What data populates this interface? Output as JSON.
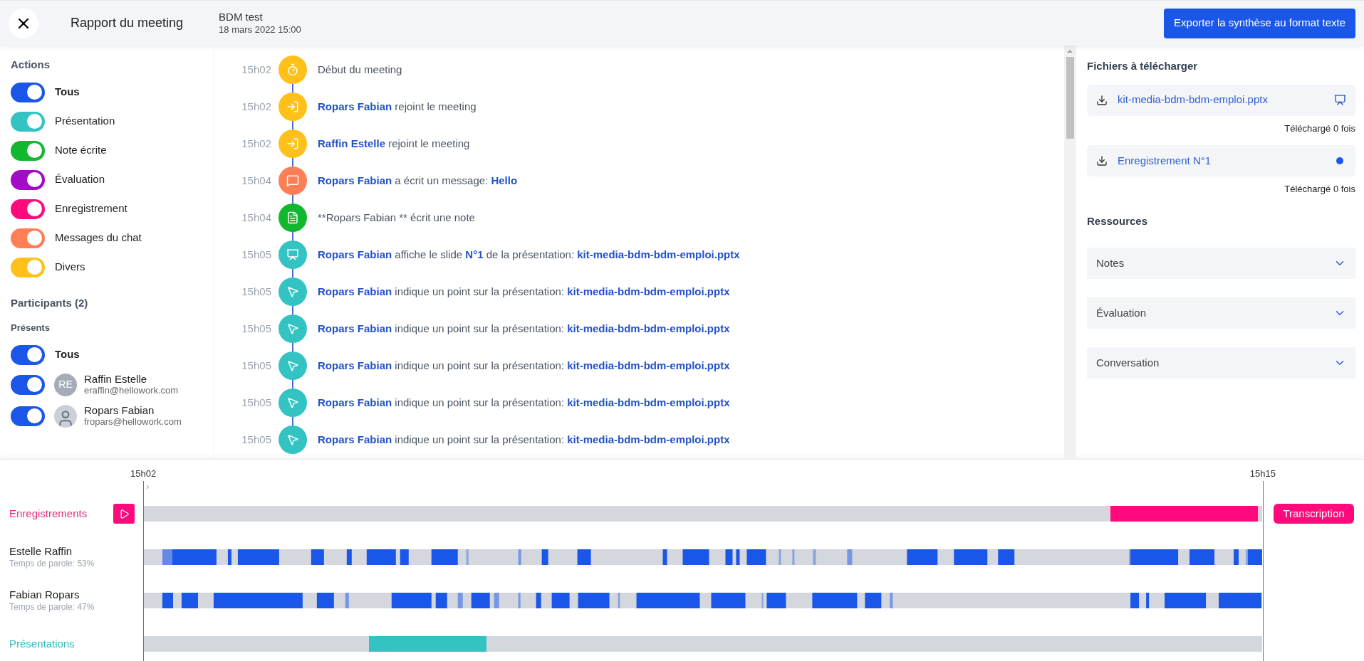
{
  "header": {
    "title": "Rapport du meeting",
    "meeting_name": "BDM test",
    "meeting_date": "18 mars 2022 15:00",
    "export_button": "Exporter la synthèse au format texte"
  },
  "actions": {
    "title": "Actions",
    "items": [
      {
        "label": "Tous",
        "on": true,
        "color": "#1a56e8",
        "bold": true
      },
      {
        "label": "Présentation",
        "on": true,
        "color": "#33c3c3",
        "bold": false
      },
      {
        "label": "Note écrite",
        "on": true,
        "color": "#10b72f",
        "bold": false
      },
      {
        "label": "Évaluation",
        "on": true,
        "color": "#a10cc4",
        "bold": false
      },
      {
        "label": "Enregistrement",
        "on": true,
        "color": "#ff0a7d",
        "bold": false
      },
      {
        "label": "Messages du chat",
        "on": true,
        "color": "#ff7e55",
        "bold": false
      },
      {
        "label": "Divers",
        "on": true,
        "color": "#ffc01a",
        "bold": false
      }
    ]
  },
  "participants": {
    "title": "Participants (2)",
    "subtitle": "Présents",
    "all": {
      "label": "Tous",
      "on": true
    },
    "people": [
      {
        "name": "Raffin Estelle",
        "email": "eraffin@hellowork.com",
        "on": true,
        "kind": "initials",
        "initials": "RE"
      },
      {
        "name": "Ropars Fabian",
        "email": "fropars@hellowork.com",
        "on": true,
        "kind": "photo"
      }
    ]
  },
  "events": [
    {
      "time": "15h02",
      "kind": "timer",
      "color": "#ffc01a",
      "text": "Début du meeting"
    },
    {
      "time": "15h02",
      "kind": "join",
      "color": "#ffc01a",
      "text": "**Ropars Fabian** rejoint le meeting"
    },
    {
      "time": "15h02",
      "kind": "join",
      "color": "#ffc01a",
      "text": "**Raffin Estelle** rejoint le meeting"
    },
    {
      "time": "15h04",
      "kind": "chat",
      "color": "#ff7e55",
      "text": "**Ropars Fabian** a écrit un message: **Hello**"
    },
    {
      "time": "15h04",
      "kind": "note",
      "color": "#10b72f",
      "text": "**Ropars Fabian ** écrit une note"
    },
    {
      "time": "15h05",
      "kind": "slide",
      "color": "#33c3c3",
      "text": "**Ropars Fabian** affiche le slide **N°1** de la présentation: **kit-media-bdm-bdm-emploi.pptx**"
    },
    {
      "time": "15h05",
      "kind": "pointer",
      "color": "#33c3c3",
      "text": "**Ropars Fabian** indique un point sur la présentation: **kit-media-bdm-bdm-emploi.pptx**"
    },
    {
      "time": "15h05",
      "kind": "pointer",
      "color": "#33c3c3",
      "text": "**Ropars Fabian** indique un point sur la présentation: **kit-media-bdm-bdm-emploi.pptx**"
    },
    {
      "time": "15h05",
      "kind": "pointer",
      "color": "#33c3c3",
      "text": "**Ropars Fabian** indique un point sur la présentation: **kit-media-bdm-bdm-emploi.pptx**"
    },
    {
      "time": "15h05",
      "kind": "pointer",
      "color": "#33c3c3",
      "text": "**Ropars Fabian** indique un point sur la présentation: **kit-media-bdm-bdm-emploi.pptx**"
    },
    {
      "time": "15h05",
      "kind": "pointer",
      "color": "#33c3c3",
      "text": "**Ropars Fabian** indique un point sur la présentation: **kit-media-bdm-bdm-emploi.pptx**"
    }
  ],
  "files": {
    "title": "Fichiers à télécharger",
    "items": [
      {
        "name": "kit-media-bdm-bdm-emploi.pptx",
        "kind": "presentation",
        "downloads": "Téléchargé 0 fois"
      },
      {
        "name": "Enregistrement N°1",
        "kind": "recording",
        "downloads": "Téléchargé 0 fois"
      }
    ]
  },
  "resources": {
    "title": "Ressources",
    "items": [
      {
        "label": "Notes",
        "expanded": false
      },
      {
        "label": "Évaluation",
        "expanded": false
      },
      {
        "label": "Conversation",
        "expanded": false
      }
    ]
  },
  "timeline": {
    "start_label": "15h02",
    "end_label": "15h15",
    "transcription_button": "Transcription",
    "tracks": [
      {
        "kind": "recording",
        "label": "Enregistrements"
      },
      {
        "kind": "speaker",
        "label": "Estelle Raffin",
        "speaking_time": "Temps de parole: 53%"
      },
      {
        "kind": "speaker",
        "label": "Fabian Ropars",
        "speaking_time": "Temps de parole: 47%"
      },
      {
        "kind": "presentation",
        "label": "Présentations"
      }
    ]
  }
}
